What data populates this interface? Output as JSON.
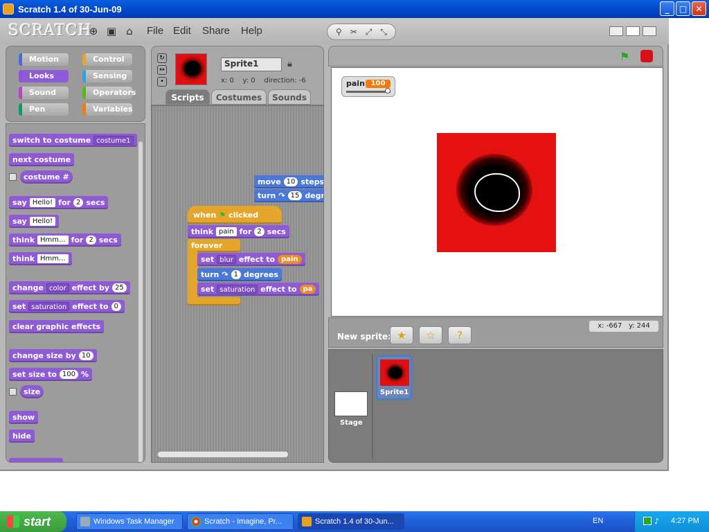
{
  "window": {
    "title": "Scratch 1.4 of 30-Jun-09",
    "minimize": "_",
    "maximize": "□",
    "close": "✕"
  },
  "menubar": {
    "logo": "SCRATCH",
    "menus": [
      "File",
      "Edit",
      "Share",
      "Help"
    ]
  },
  "categories": [
    {
      "label": "Motion",
      "color": "#4a6cd4"
    },
    {
      "label": "Control",
      "color": "#e6a822"
    },
    {
      "label": "Looks",
      "color": "#8a55d7"
    },
    {
      "label": "Sensing",
      "color": "#2ca5e2"
    },
    {
      "label": "Sound",
      "color": "#bb42c3"
    },
    {
      "label": "Operators",
      "color": "#5cb712"
    },
    {
      "label": "Pen",
      "color": "#0e9a6c"
    },
    {
      "label": "Variables",
      "color": "#ee7d16"
    }
  ],
  "palette": {
    "switch_costume": "switch to costume",
    "costume1": "costume1",
    "next_costume": "next costume",
    "costume_num": "costume #",
    "say": "say",
    "hello": "Hello!",
    "for": "for",
    "two": "2",
    "secs": "secs",
    "think": "think",
    "hmm": "Hmm...",
    "change": "change",
    "color": "color",
    "effect_by": "effect by",
    "twentyfive": "25",
    "set": "set",
    "saturation": "saturation",
    "effect_to": "effect to",
    "zero": "0",
    "clear_effects": "clear graphic effects",
    "change_size_by": "change size by",
    "ten": "10",
    "set_size_to": "set size to",
    "hundred": "100",
    "pct": "%",
    "size": "size",
    "show": "show",
    "hide": "hide"
  },
  "sprite": {
    "name": "Sprite1",
    "x": "x: 0",
    "y": "y: 0",
    "direction": "direction: -6"
  },
  "tabs": [
    "Scripts",
    "Costumes",
    "Sounds"
  ],
  "script": {
    "move": "move",
    "move_val": "10",
    "steps": "steps",
    "turn": "turn",
    "turn_val": "15",
    "degrees_cut": "degr",
    "when": "when",
    "clicked": "clicked",
    "think": "think",
    "pain": "pain",
    "for": "for",
    "two": "2",
    "secs": "secs",
    "forever": "forever",
    "set": "set",
    "blur": "blur",
    "effect_to": "effect to",
    "turn2": "turn",
    "one": "1",
    "degrees": "degrees",
    "saturation": "saturation",
    "pain_cut": "pa"
  },
  "stage": {
    "watcher_label": "pain",
    "watcher_value": "100",
    "mouse_x": "x: -667",
    "mouse_y": "y: 244"
  },
  "new_sprite": {
    "label": "New sprite:"
  },
  "sprite_list": {
    "stage_label": "Stage",
    "sprite_label": "Sprite1"
  },
  "taskbar": {
    "start": "start",
    "tasks": [
      "Windows Task Manager",
      "Scratch - Imagine, Pr...",
      "Scratch 1.4 of 30-Jun..."
    ],
    "lang": "EN",
    "time": "4:27 PM"
  }
}
